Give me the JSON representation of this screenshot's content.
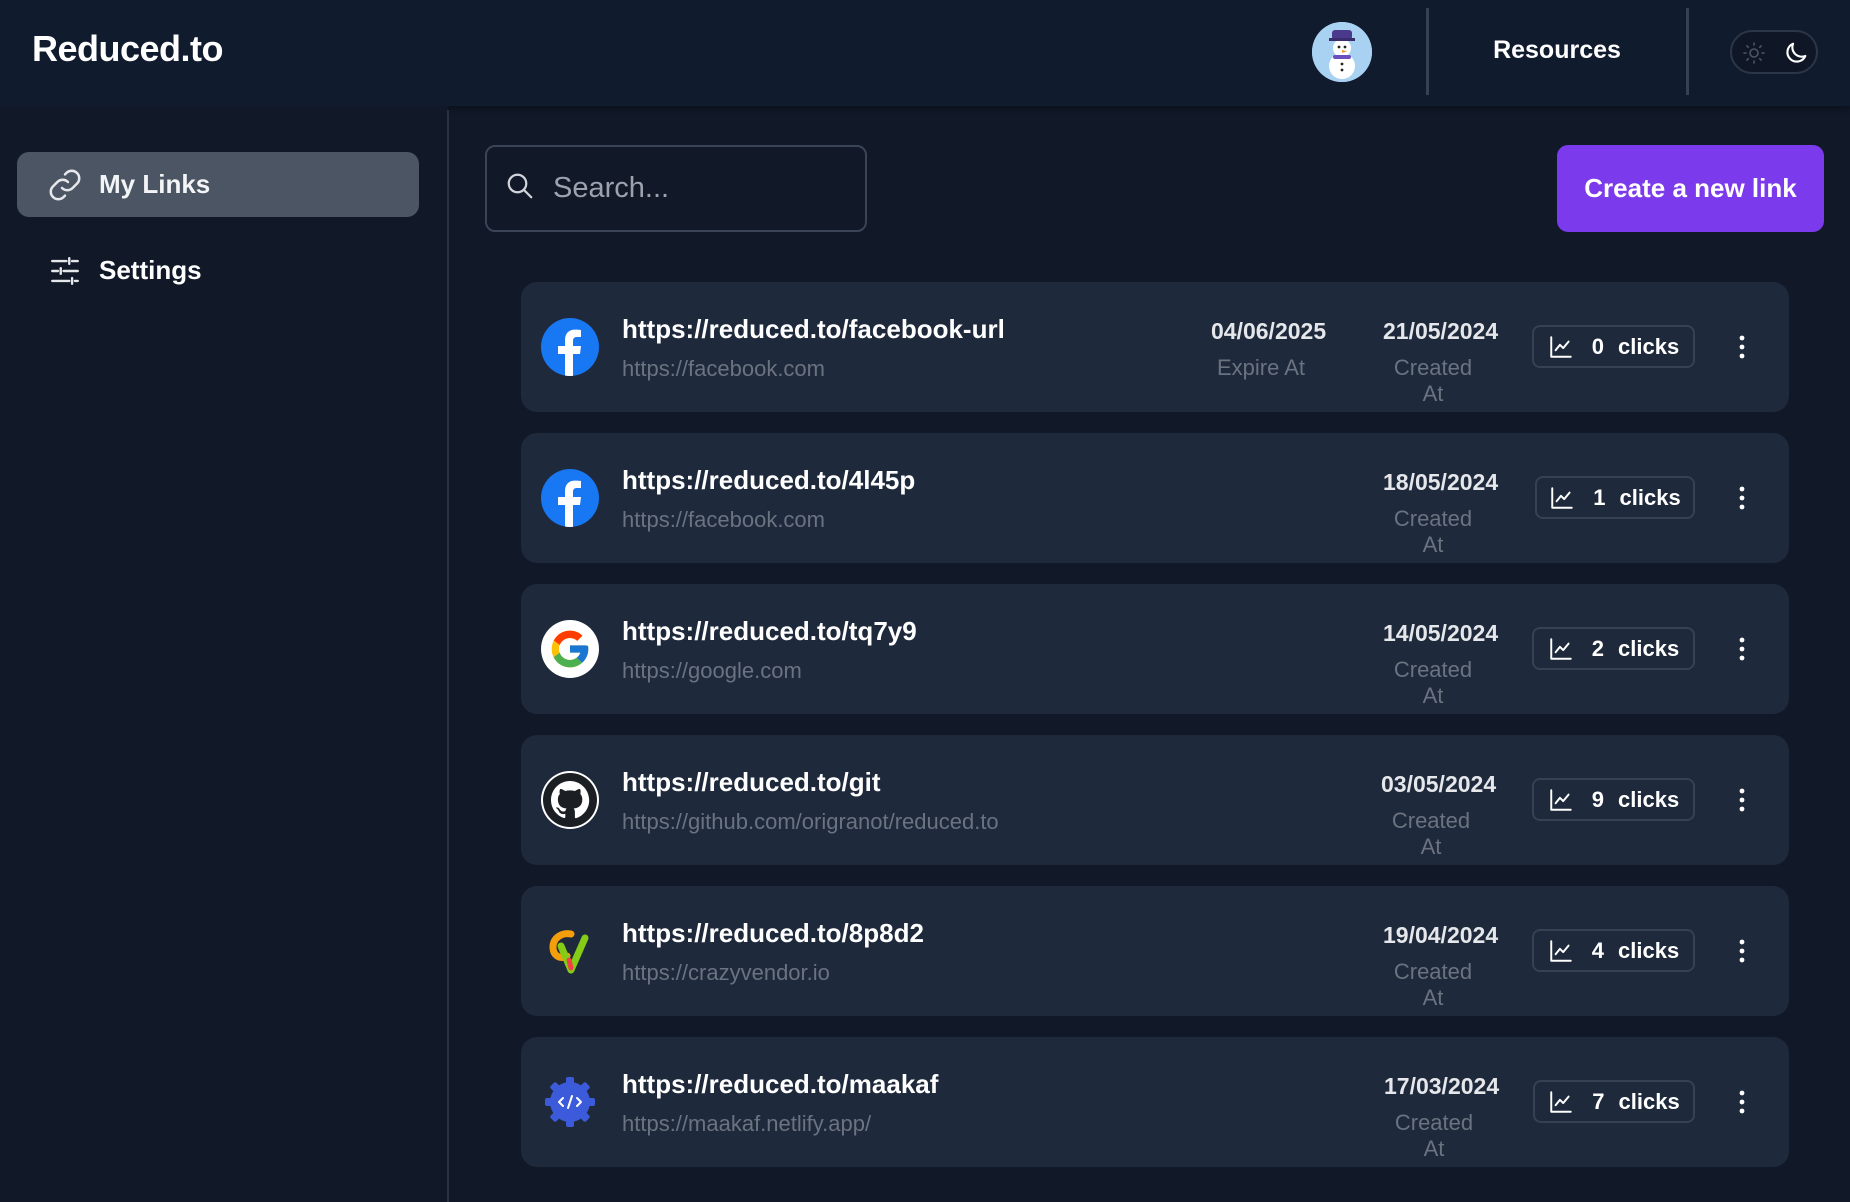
{
  "app": {
    "brand": "Reduced.to",
    "nav": {
      "resources_label": "Resources"
    },
    "theme_toggle": {
      "light_icon": "sun-icon",
      "dark_icon": "moon-icon"
    },
    "avatar": {
      "icon": "snowman-avatar"
    }
  },
  "sidebar": {
    "items": [
      {
        "label": "My Links",
        "icon": "link-icon",
        "active": true
      },
      {
        "label": "Settings",
        "icon": "sliders-icon",
        "active": false
      }
    ]
  },
  "toolbar": {
    "search_placeholder": "Search...",
    "create_label": "Create a new link"
  },
  "colors": {
    "accent": "#7c3aed",
    "background": "#111827",
    "card": "#1e293b",
    "active_sidebar": "#4b5563"
  },
  "links": [
    {
      "short": "https://reduced.to/facebook-url",
      "long": "https://facebook.com",
      "expire": "04/06/2025",
      "expire_label": "Expire At",
      "created": "21/05/2024",
      "created_label": "Created At",
      "clicks": "0",
      "clicks_label": "clicks",
      "icon": "facebook-icon"
    },
    {
      "short": "https://reduced.to/4l45p",
      "long": "https://facebook.com",
      "created": "18/05/2024",
      "created_label": "Created At",
      "clicks": "1",
      "clicks_label": "clicks",
      "icon": "facebook-icon"
    },
    {
      "short": "https://reduced.to/tq7y9",
      "long": "https://google.com",
      "created": "14/05/2024",
      "created_label": "Created At",
      "clicks": "2",
      "clicks_label": "clicks",
      "icon": "google-icon"
    },
    {
      "short": "https://reduced.to/git",
      "long": "https://github.com/origranot/reduced.to",
      "created": "03/05/2024",
      "created_label": "Created At",
      "clicks": "9",
      "clicks_label": "clicks",
      "icon": "github-icon"
    },
    {
      "short": "https://reduced.to/8p8d2",
      "long": "https://crazyvendor.io",
      "created": "19/04/2024",
      "created_label": "Created At",
      "clicks": "4",
      "clicks_label": "clicks",
      "icon": "crazyvendor-icon"
    },
    {
      "short": "https://reduced.to/maakaf",
      "long": "https://maakaf.netlify.app/",
      "created": "17/03/2024",
      "created_label": "Created At",
      "clicks": "7",
      "clicks_label": "clicks",
      "icon": "maakaf-gear-icon"
    }
  ]
}
